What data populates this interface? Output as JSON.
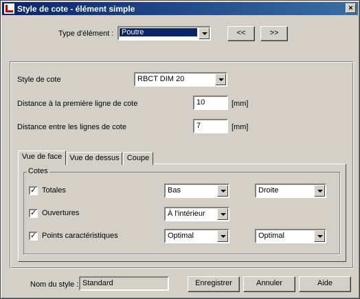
{
  "window": {
    "title": "Style de cote - élément simple",
    "close_glyph": "×"
  },
  "top": {
    "type_label": "Type d'élément :",
    "type_value": "Poutre",
    "prev_label": "<<",
    "next_label": ">>"
  },
  "settings": {
    "style_label": "Style de cote",
    "style_value": "RBCT DIM 20",
    "dist_first_label": "Distance à la première ligne de cote",
    "dist_first_value": "10",
    "dist_first_unit": "[mm]",
    "dist_between_label": "Distance entre les lignes de cote",
    "dist_between_value": "7",
    "dist_between_unit": "[mm]"
  },
  "tabs": [
    {
      "label": "Vue de face",
      "active": true
    },
    {
      "label": "Vue de dessus",
      "active": false
    },
    {
      "label": "Coupe",
      "active": false
    }
  ],
  "cotes": {
    "group_title": "Cotes",
    "rows": [
      {
        "label": "Totales",
        "checked": true,
        "opt1": "Bas",
        "opt2": "Droite"
      },
      {
        "label": "Ouvertures",
        "checked": true,
        "opt1": "À l'intérieur",
        "opt2": ""
      },
      {
        "label": "Points caractéristiques",
        "checked": true,
        "opt1": "Optimal",
        "opt2": "Optimal"
      }
    ]
  },
  "footer": {
    "style_name_label": "Nom du style :",
    "style_name_value": "Standard",
    "save_label": "Enregistrer",
    "cancel_label": "Annuler",
    "help_label": "Aide"
  }
}
